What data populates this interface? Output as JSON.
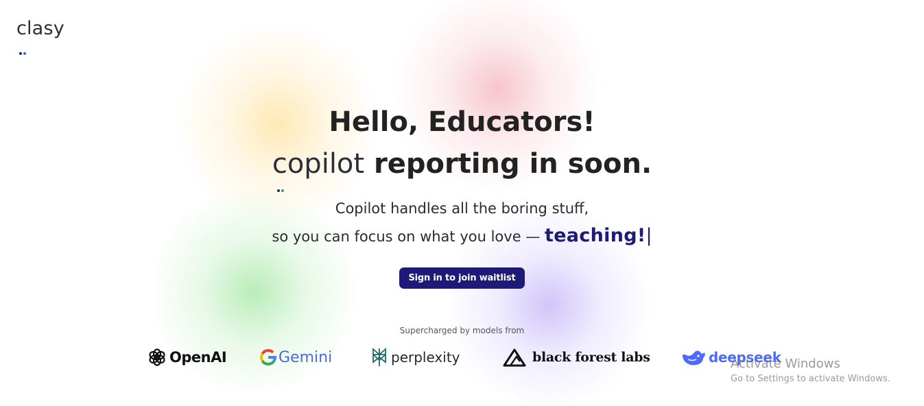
{
  "brand": {
    "name": "clasy",
    "dot_colors": [
      "#1f1a78",
      "#2f6fe0"
    ]
  },
  "hero": {
    "title_line1": "Hello, Educators!",
    "title_brand": "copilot",
    "title_line2_rest": " reporting in soon.",
    "subtitle_line1": "Copilot handles all the boring stuff,",
    "subtitle_line2": "so you can focus on what you love — ",
    "highlight": "teaching!",
    "caret": "|",
    "inline_dot_colors": [
      "#2c1f8a",
      "#34a853"
    ]
  },
  "cta": {
    "label": "Sign in to join waitlist"
  },
  "models": {
    "caption": "Supercharged by models from",
    "items": [
      {
        "name": "OpenAI",
        "icon": "openai-knot-icon"
      },
      {
        "name": "Gemini",
        "icon": "google-g-icon"
      },
      {
        "name": "perplexity",
        "icon": "perplexity-icon"
      },
      {
        "name": "black forest labs",
        "icon": "triangle-icon"
      },
      {
        "name": "deepseek",
        "icon": "whale-icon"
      }
    ]
  },
  "watermark": {
    "title": "Activate Windows",
    "subtitle": "Go to Settings to activate Windows."
  },
  "colors": {
    "accent": "#1f1a78",
    "deepseek_blue": "#4d6bfe"
  }
}
